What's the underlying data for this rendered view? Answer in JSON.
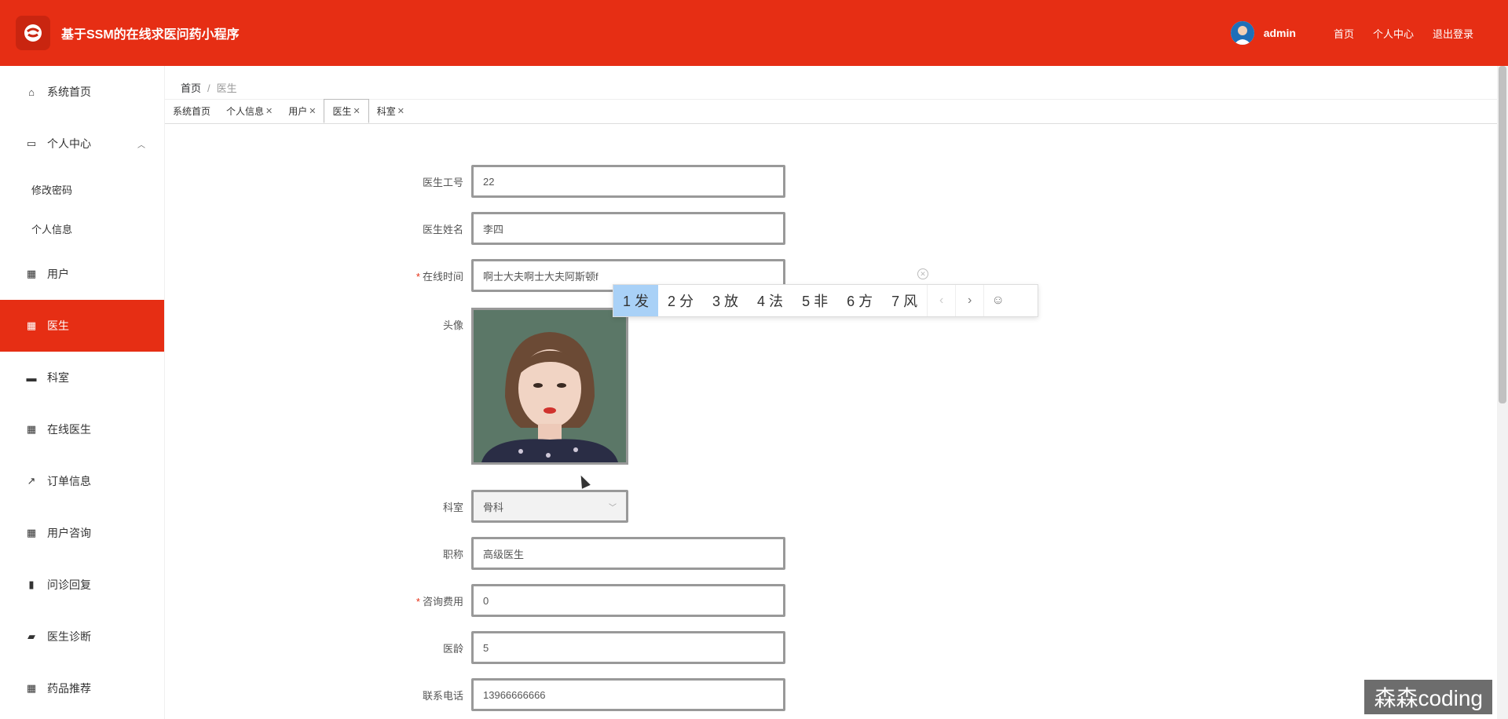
{
  "header": {
    "title": "基于SSM的在线求医问药小程序",
    "username": "admin",
    "links": [
      "首页",
      "个人中心",
      "退出登录"
    ]
  },
  "sidebar": {
    "items": [
      {
        "label": "系统首页",
        "icon": "home-icon"
      },
      {
        "label": "个人中心",
        "icon": "card-icon"
      },
      {
        "label": "修改密码"
      },
      {
        "label": "个人信息"
      },
      {
        "label": "用户",
        "icon": "grid-icon"
      },
      {
        "label": "医生",
        "icon": "grid-icon"
      },
      {
        "label": "科室",
        "icon": "briefcase-icon"
      },
      {
        "label": "在线医生",
        "icon": "grid-icon"
      },
      {
        "label": "订单信息",
        "icon": "trend-icon"
      },
      {
        "label": "用户咨询",
        "icon": "grid-icon"
      },
      {
        "label": "问诊回复",
        "icon": "bar-chart-icon"
      },
      {
        "label": "医生诊断",
        "icon": "wallet-icon"
      },
      {
        "label": "药品推荐",
        "icon": "grid-icon"
      }
    ]
  },
  "breadcrumb": {
    "home": "首页",
    "current": "医生"
  },
  "tabs": [
    {
      "label": "系统首页",
      "closable": false
    },
    {
      "label": "个人信息",
      "closable": true
    },
    {
      "label": "用户",
      "closable": true
    },
    {
      "label": "医生",
      "closable": true,
      "active": true
    },
    {
      "label": "科室",
      "closable": true
    }
  ],
  "form": {
    "doctor_id": {
      "label": "医生工号",
      "value": "22"
    },
    "doctor_name": {
      "label": "医生姓名",
      "value": "李四"
    },
    "online_time": {
      "label": "在线时间",
      "value": "啊士大夫啊士大夫阿斯顿f",
      "required": true
    },
    "avatar": {
      "label": "头像"
    },
    "department": {
      "label": "科室",
      "value": "骨科"
    },
    "title": {
      "label": "职称",
      "value": "高级医生"
    },
    "fee": {
      "label": "咨询费用",
      "value": "0",
      "required": true
    },
    "years": {
      "label": "医龄",
      "value": "5"
    },
    "phone": {
      "label": "联系电话",
      "value": "13966666666"
    }
  },
  "ime": {
    "candidates": [
      "1 发",
      "2 分",
      "3 放",
      "4 法",
      "5 非",
      "6 方",
      "7 风"
    ]
  },
  "watermark": "森森coding",
  "colors": {
    "primary": "#e62e14"
  }
}
